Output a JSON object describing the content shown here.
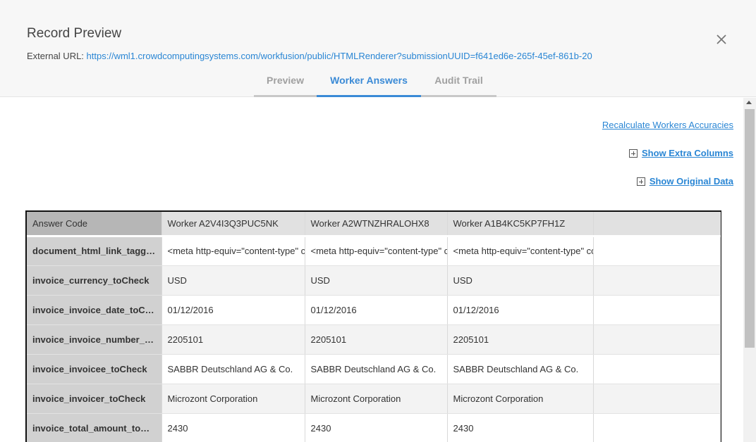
{
  "header": {
    "title": "Record Preview",
    "external_url_label": "External URL:",
    "external_url": "https://wml1.crowdcomputingsystems.com/workfusion/public/HTMLRenderer?submissionUUID=f641ed6e-265f-45ef-861b-20",
    "close_icon": "close-icon"
  },
  "tabs": [
    {
      "label": "Preview",
      "active": false
    },
    {
      "label": "Worker Answers",
      "active": true
    },
    {
      "label": "Audit Trail",
      "active": false
    }
  ],
  "actions": {
    "recalculate": "Recalculate Workers Accuracies",
    "show_extra_columns": "Show Extra Columns",
    "show_original_data": "Show Original Data"
  },
  "table": {
    "headers": [
      "Answer Code",
      "Worker A2V4I3Q3PUC5NK",
      "Worker A2WTNZHRALOHX8",
      "Worker A1B4KC5KP7FH1Z",
      ""
    ],
    "rows": [
      {
        "code": "document_html_link_tagge...",
        "values": [
          "<meta http-equiv=\"content-type\" content",
          "<meta http-equiv=\"content-type\" content",
          "<meta http-equiv=\"content-type\" content",
          ""
        ]
      },
      {
        "code": "invoice_currency_toCheck",
        "values": [
          "USD",
          "USD",
          "USD",
          ""
        ]
      },
      {
        "code": "invoice_invoice_date_toChe...",
        "values": [
          "01/12/2016",
          "01/12/2016",
          "01/12/2016",
          ""
        ]
      },
      {
        "code": "invoice_invoice_number_to...",
        "values": [
          "2205101",
          "2205101",
          "2205101",
          ""
        ]
      },
      {
        "code": "invoice_invoicee_toCheck",
        "values": [
          "SABBR Deutschland AG & Co.",
          "SABBR Deutschland AG & Co.",
          "SABBR Deutschland AG & Co.",
          ""
        ]
      },
      {
        "code": "invoice_invoicer_toCheck",
        "values": [
          "Microzont Corporation",
          "Microzont Corporation",
          "Microzont Corporation",
          ""
        ]
      },
      {
        "code": "invoice_total_amount_toCh...",
        "values": [
          "2430",
          "2430",
          "2430",
          ""
        ]
      }
    ]
  },
  "colors": {
    "accent": "#3a8ad6",
    "link": "#2a86d4"
  }
}
